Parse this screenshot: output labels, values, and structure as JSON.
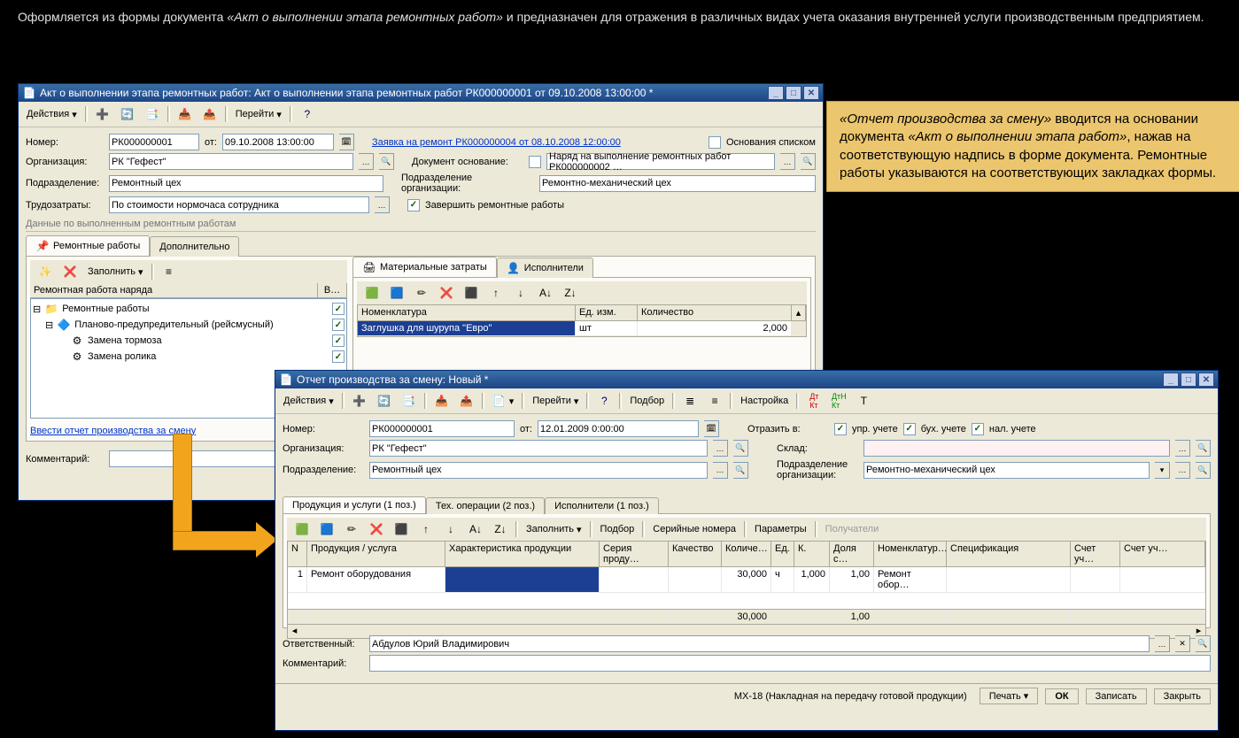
{
  "top_text_prefix": "Оформляется из формы документа ",
  "top_text_doc": "«Акт о выполнении этапа ремонтных работ»",
  "top_text_suffix": " и предназначен для отражения в различных видах учета оказания внутренней услуги производственным предприятием.",
  "callout": {
    "em1": "«Отчет производства за смену»",
    "t1": " вводится на основании документа ",
    "em2": "«Акт о выполнении этапа работ»",
    "t2": ", нажав на соответствующую надпись в форме документа.  Ремонтные работы указываются на соответствующих закладках формы."
  },
  "win1": {
    "title": "Акт о выполнении этапа ремонтных работ: Акт о выполнении этапа ремонтных работ РК000000001 от 09.10.2008 13:00:00 *",
    "actions": "Действия",
    "goto": "Перейти",
    "lbl_number": "Номер:",
    "number": "РК000000001",
    "lbl_from": "от:",
    "date": "09.10.2008 13:00:00",
    "link": "Заявка на ремонт РК000000004 от 08.10.2008 12:00:00",
    "chk_list": "Основания списком",
    "lbl_org": "Организация:",
    "org": "РК \"Гефест\"",
    "lbl_basedoc": "Документ основание:",
    "basedoc": "Наряд на выполнение ремонтных работ РК000000002 …",
    "lbl_dept": "Подразделение:",
    "dept": "Ремонтный цех",
    "lbl_dept_org": "Подразделение организации:",
    "dept_org": "Ремонтно-механический цех",
    "lbl_labor": "Трудозатраты:",
    "labor": "По стоимости нормочаса сотрудника",
    "chk_finish": "Завершить ремонтные работы",
    "group": "Данные по выполненным ремонтным работам",
    "tab_repair": "Ремонтные работы",
    "tab_more": "Дополнительно",
    "fill": "Заполнить",
    "tree_hdr": "Ремонтная работа наряда",
    "tree_hdr_b": "В…",
    "tree_root": "Ремонтные работы",
    "tree_ppr": "Планово-предупредительный (рейсмусный)",
    "tree_brake": "Замена тормоза",
    "tree_roller": "Замена ролика",
    "subtab_mat": "Материальные затраты",
    "subtab_exec": "Исполнители",
    "col_nom": "Номенклатура",
    "col_unit": "Ед. изм.",
    "col_qty": "Количество",
    "row_nom": "Заглушка для шурупа \"Евро\"",
    "row_unit": "шт",
    "row_qty": "2,000",
    "enter_report": "Ввести отчет производства за смену",
    "lbl_comment": "Комментарий:"
  },
  "win2": {
    "title": "Отчет производства за смену: Новый *",
    "actions": "Действия",
    "goto": "Перейти",
    "pick": "Подбор",
    "settings": "Настройка",
    "lbl_number": "Номер:",
    "number": "РК000000001",
    "lbl_from": "от:",
    "date": "12.01.2009  0:00:00",
    "lbl_reflect": "Отразить в:",
    "chk_upr": "упр. учете",
    "chk_bux": "бух. учете",
    "chk_nal": "нал. учете",
    "lbl_org": "Организация:",
    "org": "РК \"Гефест\"",
    "lbl_stock": "Склад:",
    "lbl_dept": "Подразделение:",
    "dept": "Ремонтный цех",
    "lbl_dept_org": "Подразделение организации:",
    "dept_org": "Ремонтно-механический цех",
    "tab_prod": "Продукция и услуги (1 поз.)",
    "tab_tech": "Тех. операции (2 поз.)",
    "tab_exec": "Исполнители (1 поз.)",
    "fill": "Заполнить",
    "pick2": "Подбор",
    "serial": "Серийные номера",
    "params": "Параметры",
    "recip": "Получатели",
    "col_n": "N",
    "col_prod": "Продукция / услуга",
    "col_char": "Характеристика продукции",
    "col_series": "Серия проду…",
    "col_quality": "Качество",
    "col_qty": "Количе…",
    "col_unit": "Ед.",
    "col_k": "К.",
    "col_share": "Доля с…",
    "col_nomgroup": "Номенклатур…",
    "col_spec": "Спецификация",
    "col_acc1": "Счет уч…",
    "col_acc2": "Счет уч…",
    "row_n": "1",
    "row_prod": "Ремонт оборудования",
    "row_qty": "30,000",
    "row_unit": "ч",
    "row_k": "1,000",
    "row_share": "1,00",
    "row_nomgroup": "Ремонт обор…",
    "sum_qty": "30,000",
    "sum_share": "1,00",
    "lbl_resp": "Ответственный:",
    "resp": "Абдулов Юрий Владимирович",
    "lbl_comment": "Комментарий:",
    "status_mx": "МХ-18 (Накладная на передачу готовой продукции)",
    "btn_print": "Печать",
    "btn_ok": "ОК",
    "btn_save": "Записать",
    "btn_close": "Закрыть"
  }
}
